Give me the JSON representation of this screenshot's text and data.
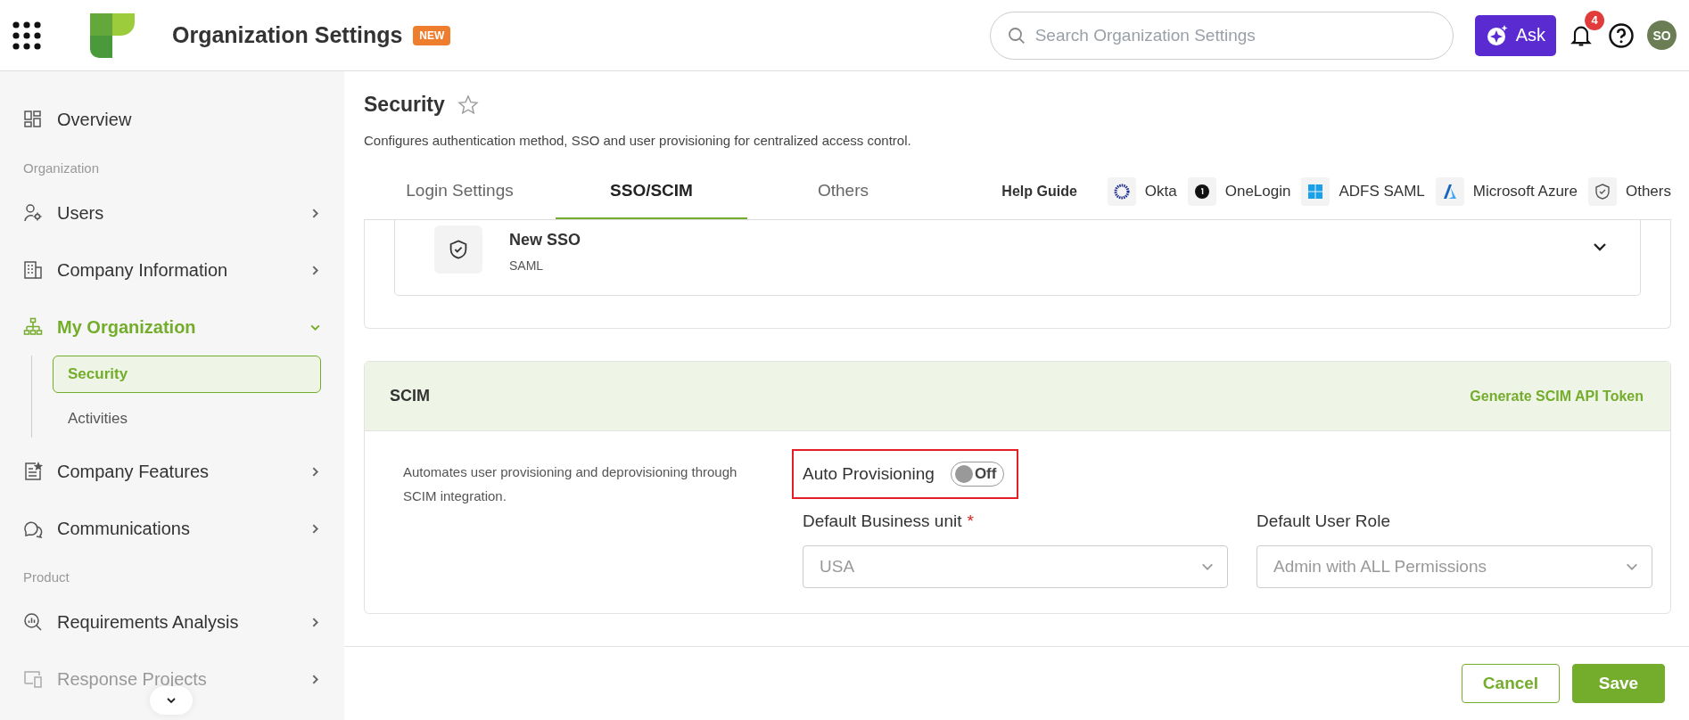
{
  "header": {
    "title": "Organization Settings",
    "badge": "NEW",
    "search": {
      "placeholder": "Search Organization Settings"
    },
    "ask_button": "Ask",
    "notifications": "4",
    "avatar": "SO"
  },
  "sidebar": {
    "items": [
      {
        "kind": "item",
        "label": "Overview",
        "selected": false,
        "dimmed": false
      },
      {
        "kind": "section",
        "label": "Organization"
      },
      {
        "kind": "item",
        "label": "Users",
        "selected": false,
        "expanded": false,
        "dimmed": false
      },
      {
        "kind": "item",
        "label": "Company Information",
        "selected": false,
        "expanded": false,
        "dimmed": false
      },
      {
        "kind": "item",
        "label": "My Organization",
        "selected": true,
        "expanded": true,
        "dimmed": false,
        "children": [
          {
            "label": "Security",
            "selected": true
          },
          {
            "label": "Activities",
            "selected": false
          }
        ]
      },
      {
        "kind": "item",
        "label": "Company Features",
        "selected": false,
        "expanded": false,
        "dimmed": false
      },
      {
        "kind": "item",
        "label": "Communications",
        "selected": false,
        "expanded": false,
        "dimmed": false
      },
      {
        "kind": "section",
        "label": "Product"
      },
      {
        "kind": "item",
        "label": "Requirements Analysis",
        "selected": false,
        "expanded": false,
        "dimmed": false
      },
      {
        "kind": "item",
        "label": "Response Projects",
        "selected": false,
        "expanded": false,
        "dimmed": true
      }
    ]
  },
  "page": {
    "title": "Security",
    "starred": false,
    "description": "Configures authentication method, SSO and user provisioning for centralized access control.",
    "tabs": [
      {
        "label": "Login Settings",
        "selected": false
      },
      {
        "label": "SSO/SCIM",
        "selected": true
      },
      {
        "label": "Others",
        "selected": false
      }
    ],
    "help_guide": {
      "label": "Help Guide",
      "links": [
        "Okta",
        "OneLogin",
        "ADFS SAML",
        "Microsoft Azure",
        "Others"
      ]
    },
    "sso_card": {
      "name": "New SSO",
      "type": "SAML",
      "expanded": false
    },
    "scim": {
      "title": "SCIM",
      "action": "Generate SCIM API Token",
      "description": "Automates user provisioning and deprovisioning through SCIM integration.",
      "auto_provisioning": {
        "label": "Auto Provisioning",
        "on": false,
        "state_text": "Off",
        "highlighted": true
      },
      "fields": [
        {
          "label": "Default Business unit",
          "required_mark": "*",
          "value": "USA",
          "disabled": true
        },
        {
          "label": "Default User Role",
          "value": "Admin with ALL Permissions",
          "disabled": true
        }
      ]
    }
  },
  "footer": {
    "cancel": "Cancel",
    "save": "Save"
  }
}
